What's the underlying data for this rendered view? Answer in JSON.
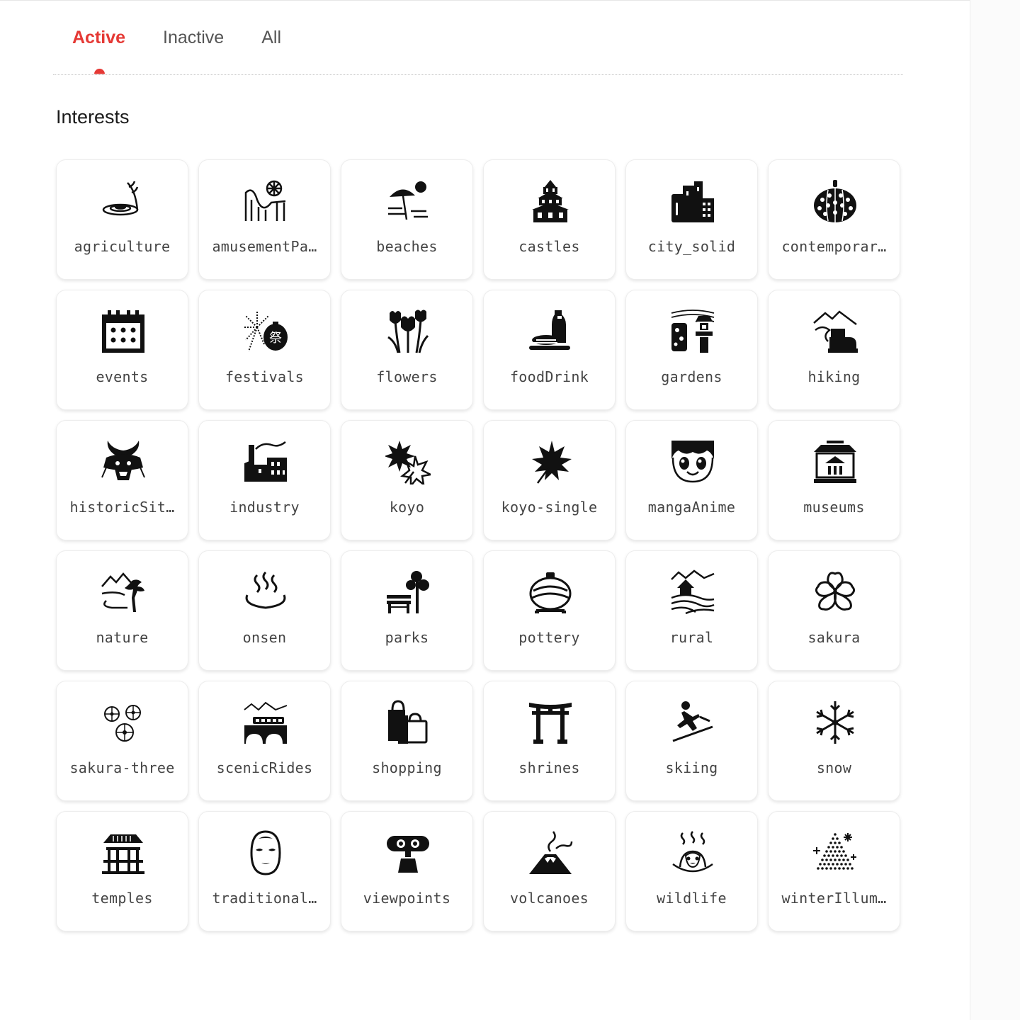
{
  "tabs": [
    {
      "label": "Active",
      "active": true
    },
    {
      "label": "Inactive",
      "active": false
    },
    {
      "label": "All",
      "active": false
    }
  ],
  "section_title": "Interests",
  "accent_color": "#e53935",
  "interests": [
    {
      "label": "agriculture",
      "icon": "rice-field-icon"
    },
    {
      "label": "amusementPa…",
      "icon": "ferris-wheel-coaster-icon"
    },
    {
      "label": "beaches",
      "icon": "beach-umbrella-icon"
    },
    {
      "label": "castles",
      "icon": "castle-icon"
    },
    {
      "label": "city_solid",
      "icon": "city-buildings-icon"
    },
    {
      "label": "contemporar…",
      "icon": "polka-dot-pumpkin-icon"
    },
    {
      "label": "events",
      "icon": "calendar-icon"
    },
    {
      "label": "festivals",
      "icon": "fireworks-lantern-icon"
    },
    {
      "label": "flowers",
      "icon": "tulips-icon"
    },
    {
      "label": "foodDrink",
      "icon": "sushi-sake-icon"
    },
    {
      "label": "gardens",
      "icon": "zen-garden-lantern-icon"
    },
    {
      "label": "hiking",
      "icon": "hiking-boot-icon"
    },
    {
      "label": "historicSit…",
      "icon": "samurai-helmet-icon"
    },
    {
      "label": "industry",
      "icon": "factory-icon"
    },
    {
      "label": "koyo",
      "icon": "autumn-leaves-icon"
    },
    {
      "label": "koyo-single",
      "icon": "maple-leaf-icon"
    },
    {
      "label": "mangaAnime",
      "icon": "anime-face-icon"
    },
    {
      "label": "museums",
      "icon": "museum-building-icon"
    },
    {
      "label": "nature",
      "icon": "mountain-pine-icon"
    },
    {
      "label": "onsen",
      "icon": "hot-spring-icon"
    },
    {
      "label": "parks",
      "icon": "park-bench-tree-icon"
    },
    {
      "label": "pottery",
      "icon": "pottery-vase-icon"
    },
    {
      "label": "rural",
      "icon": "rural-farmhouse-icon"
    },
    {
      "label": "sakura",
      "icon": "cherry-blossom-icon"
    },
    {
      "label": "sakura-three",
      "icon": "three-blossoms-icon"
    },
    {
      "label": "scenicRides",
      "icon": "train-bridge-icon"
    },
    {
      "label": "shopping",
      "icon": "shopping-bags-icon"
    },
    {
      "label": "shrines",
      "icon": "torii-gate-icon"
    },
    {
      "label": "skiing",
      "icon": "skier-icon"
    },
    {
      "label": "snow",
      "icon": "snowflake-icon"
    },
    {
      "label": "temples",
      "icon": "temple-icon"
    },
    {
      "label": "traditional…",
      "icon": "noh-mask-icon"
    },
    {
      "label": "viewpoints",
      "icon": "binocular-viewer-icon"
    },
    {
      "label": "volcanoes",
      "icon": "volcano-icon"
    },
    {
      "label": "wildlife",
      "icon": "snow-monkey-onsen-icon"
    },
    {
      "label": "winterIllum…",
      "icon": "illuminated-tree-icon"
    }
  ]
}
